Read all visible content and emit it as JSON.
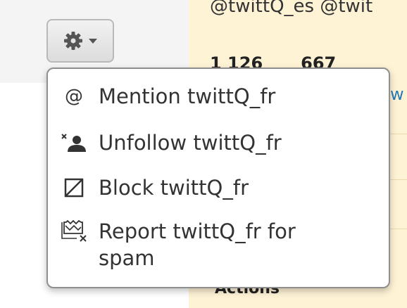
{
  "background": {
    "handles_text": "@twittQ_es @twit",
    "counts": [
      "1 126",
      "667"
    ],
    "link_fragment": "w",
    "bottom_fragment": "Actions"
  },
  "gear_button": {
    "icon": "gear-icon",
    "caret_icon": "caret-down-icon"
  },
  "menu": {
    "items": [
      {
        "icon": "at-icon",
        "icon_glyph": "@",
        "label": "Mention twittQ_fr"
      },
      {
        "icon": "unfollow-user-icon",
        "label": "Unfollow twittQ_fr"
      },
      {
        "icon": "block-icon",
        "label": "Block twittQ_fr"
      },
      {
        "icon": "report-spam-icon",
        "label": "Report twittQ_fr for spam"
      }
    ]
  },
  "colors": {
    "menu_text": "#333333",
    "profile_background": "#fff3d6",
    "link": "#2a7bb8"
  }
}
